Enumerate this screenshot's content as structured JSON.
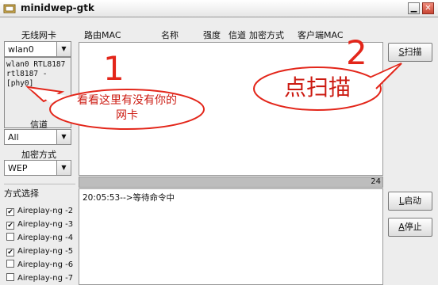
{
  "window": {
    "title": "minidwep-gtk"
  },
  "headers": {
    "nic": "无线网卡",
    "router_mac": "路由MAC",
    "name": "名称",
    "strength": "强度",
    "channel": "信道",
    "encryption": "加密方式",
    "client_mac": "客户端MAC"
  },
  "nic_combo": {
    "value": "wlan0"
  },
  "interfaces": {
    "line1": "wlan0 RTL8187",
    "line2": "rtl8187 - [phy0]"
  },
  "channel": {
    "label": "信道",
    "value": "All"
  },
  "encryption": {
    "label": "加密方式",
    "value": "WEP"
  },
  "mode": {
    "title": "方式选择",
    "options": [
      {
        "label": "Aireplay-ng -2",
        "checked": true
      },
      {
        "label": "Aireplay-ng -3",
        "checked": true
      },
      {
        "label": "Aireplay-ng -4",
        "checked": false
      },
      {
        "label": "Aireplay-ng -5",
        "checked": true
      },
      {
        "label": "Aireplay-ng -6",
        "checked": false
      },
      {
        "label": "Aireplay-ng -7",
        "checked": false
      }
    ]
  },
  "buttons": {
    "scan_mn": "S",
    "scan_rest": "扫描",
    "start_mn": "L",
    "start_rest": "启动",
    "stop_mn": "A",
    "stop_rest": "停止"
  },
  "status": {
    "count": "24"
  },
  "log": {
    "line1": "20:05:53-->等待命令中"
  },
  "annotations": {
    "num1": "1",
    "bubble1_line1": "看看这里有没有你的",
    "bubble1_line2": "网卡",
    "num2": "2",
    "bubble2": "点扫描"
  },
  "colors": {
    "annotation_red": "#e3261a",
    "log_bg": "#ffffff",
    "status_bg": "#bdbdbd"
  }
}
